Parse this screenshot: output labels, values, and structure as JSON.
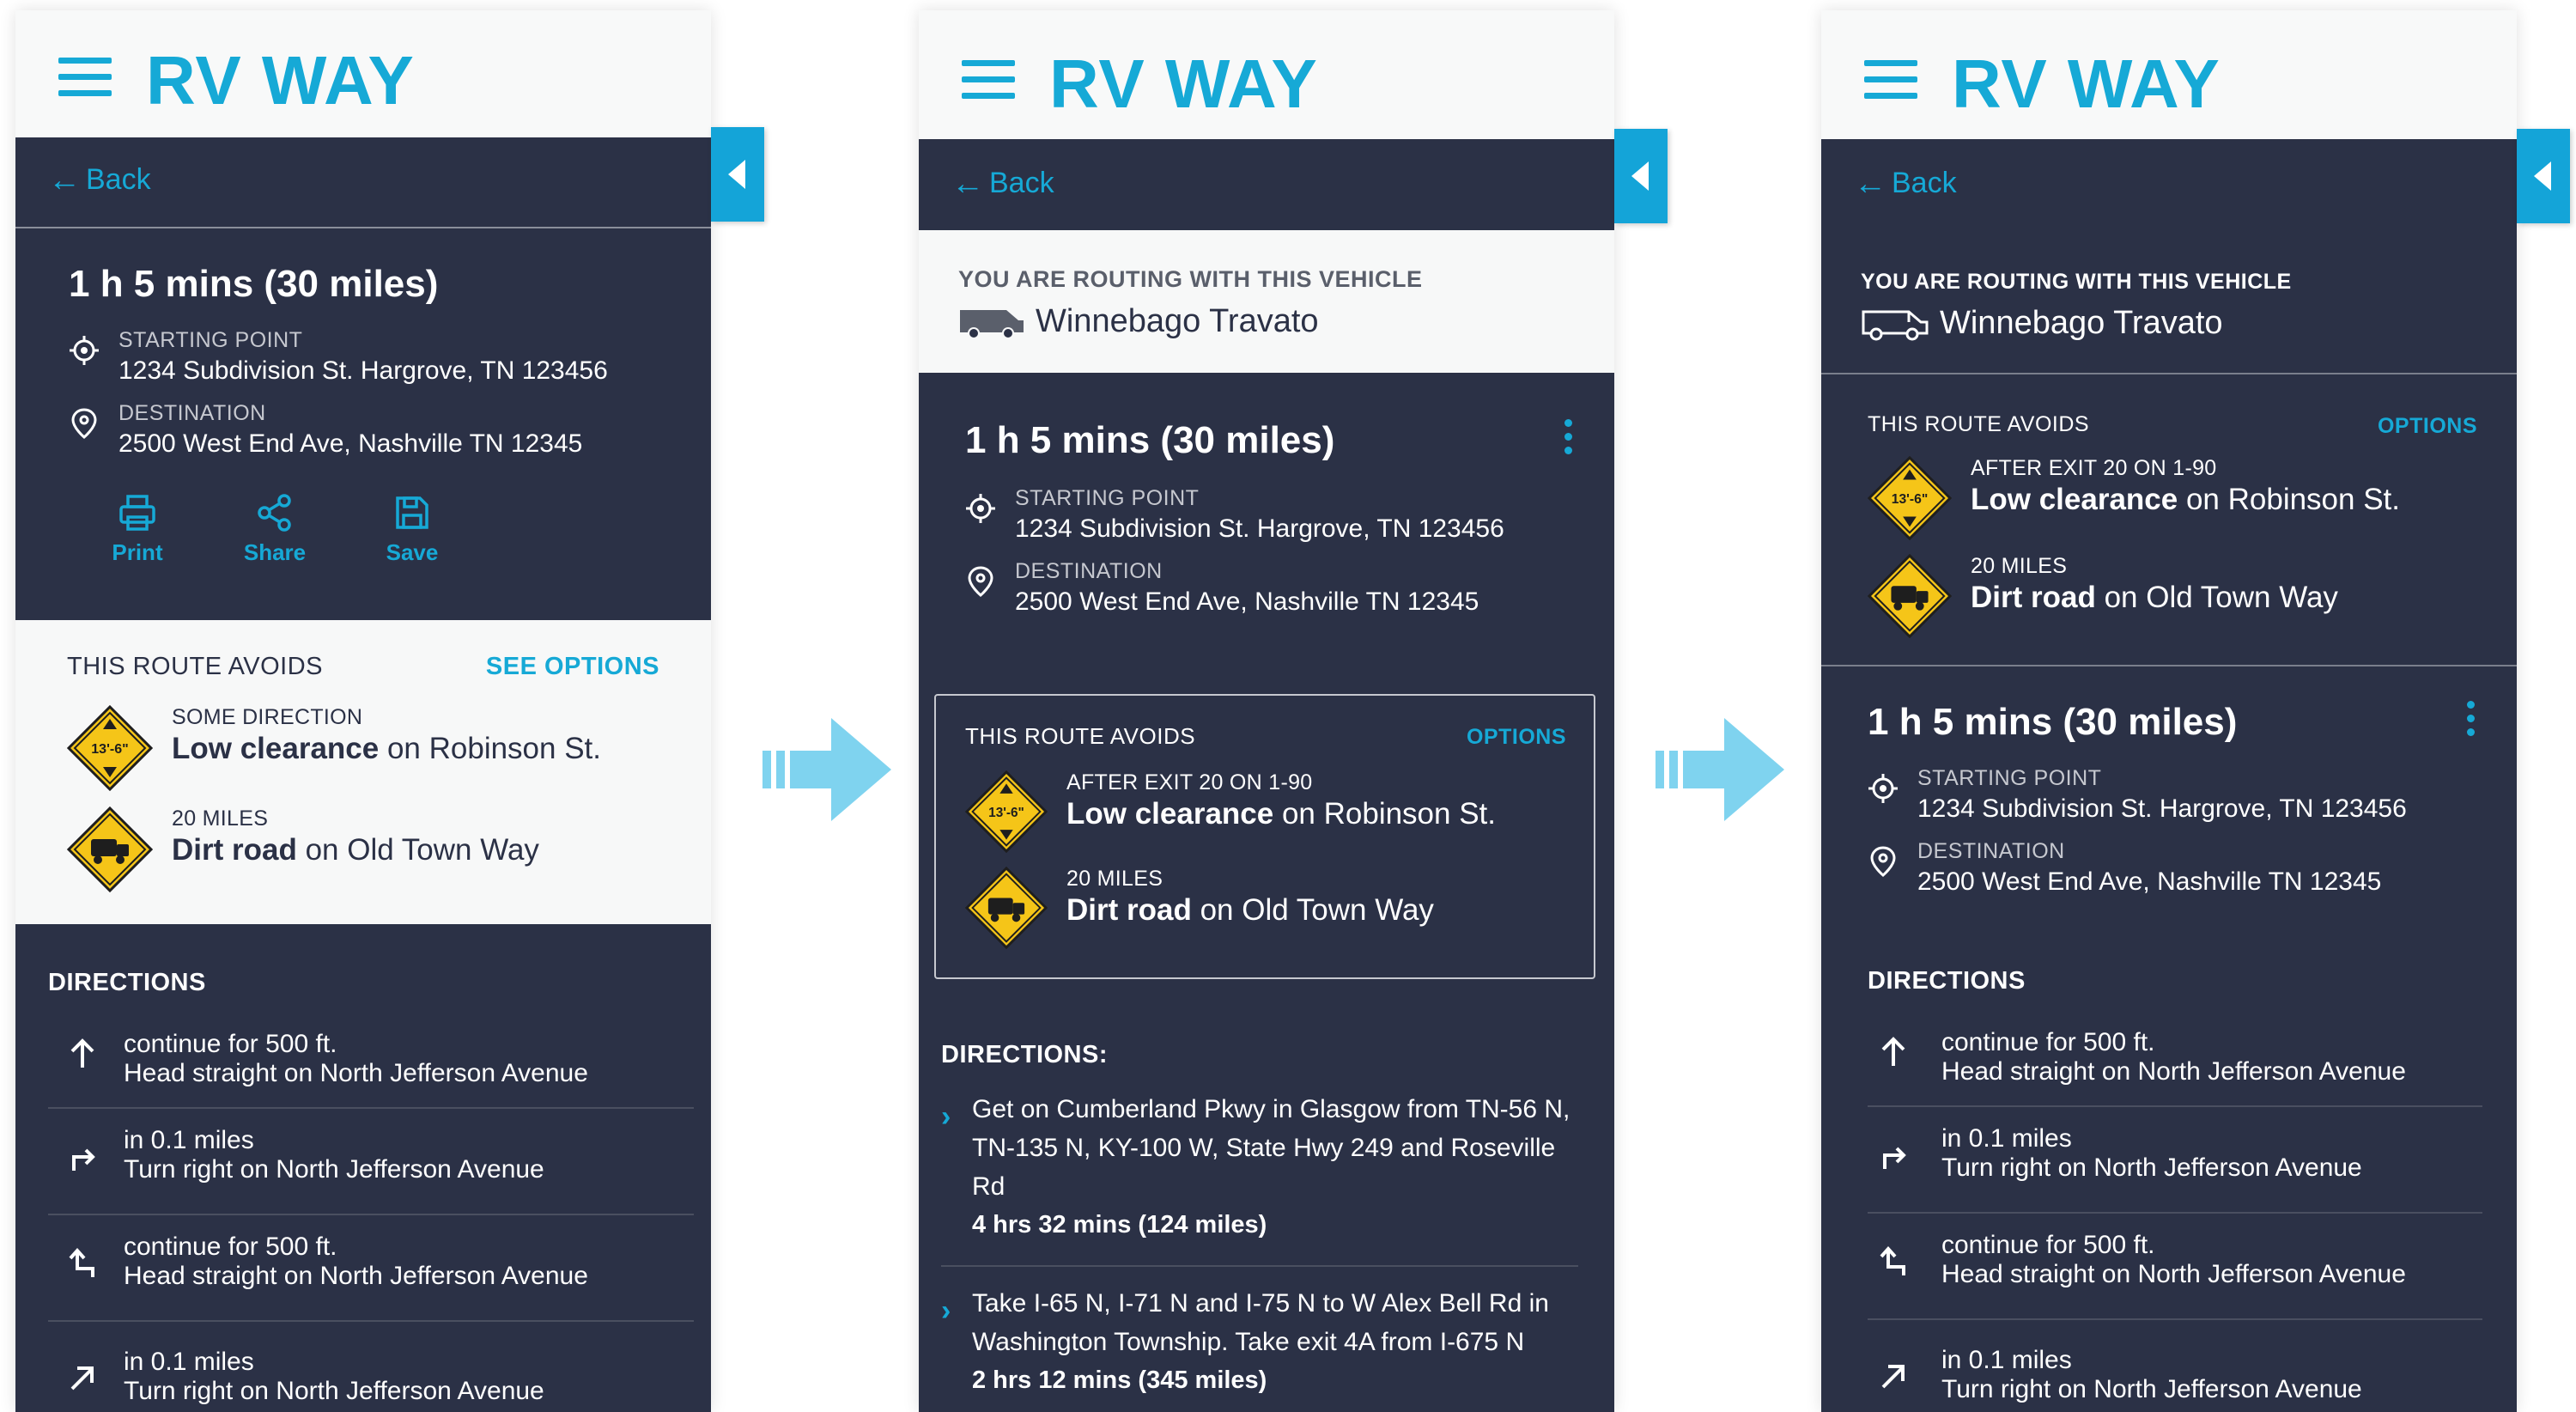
{
  "app": {
    "title": "RV WAY",
    "back_label": "Back"
  },
  "route": {
    "duration": "1 h 5 mins (30 miles)",
    "start_label": "STARTING POINT",
    "start_value": "1234 Subdivision St. Hargrove, TN 123456",
    "dest_label": "DESTINATION",
    "dest_value": "2500 West End Ave, Nashville TN 12345"
  },
  "actions": {
    "print": "Print",
    "share": "Share",
    "save": "Save"
  },
  "vehicle": {
    "label": "YOU ARE ROUTING WITH THIS VEHICLE",
    "name": "Winnebago Travato"
  },
  "avoids": {
    "heading": "THIS ROUTE AVOIDS",
    "see_options": "SEE OPTIONS",
    "options": "OPTIONS",
    "clearance_sign": "13'-6\"",
    "screen1": [
      {
        "sub": "SOME DIRECTION",
        "bold": "Low clearance",
        "rest": " on Robinson St."
      },
      {
        "sub": "20 MILES",
        "bold": "Dirt road",
        "rest": " on Old Town Way"
      }
    ],
    "screen2": [
      {
        "sub": "AFTER EXIT 20 ON 1-90",
        "bold": "Low clearance",
        "rest": " on Robinson St."
      },
      {
        "sub": "20 MILES",
        "bold": "Dirt road",
        "rest": " on Old Town Way"
      }
    ]
  },
  "directions": {
    "heading": "DIRECTIONS",
    "heading_colon": "DIRECTIONS:",
    "items": [
      {
        "line1": "continue for 500 ft.",
        "line2": "Head straight on North Jefferson Avenue",
        "icon": "arrow-up-icon"
      },
      {
        "line1": "in 0.1 miles",
        "line2": "Turn right on North Jefferson Avenue",
        "icon": "turn-right-icon"
      },
      {
        "line1": "continue for 500 ft.",
        "line2": "Head straight on North Jefferson Avenue",
        "icon": "turn-left-up-icon"
      },
      {
        "line1": "in 0.1 miles",
        "line2": "Turn right on North Jefferson Avenue",
        "icon": "arrow-up-right-icon"
      }
    ],
    "long": [
      {
        "text": "Get on Cumberland Pkwy in Glasgow from TN-56 N, TN-135 N, KY-100 W, State Hwy 249 and Roseville Rd",
        "time": "4 hrs  32 mins (124 miles)"
      },
      {
        "text": "Take I-65 N, I-71 N and I-75 N to W Alex Bell Rd in Washington Township. Take exit 4A from I-675 N",
        "time": "2 hrs  12 mins (345 miles)"
      }
    ]
  },
  "colors": {
    "accent": "#16a9d6",
    "navy": "#2b3146",
    "light": "#f7f8f8",
    "hazard": "#f5c518"
  }
}
